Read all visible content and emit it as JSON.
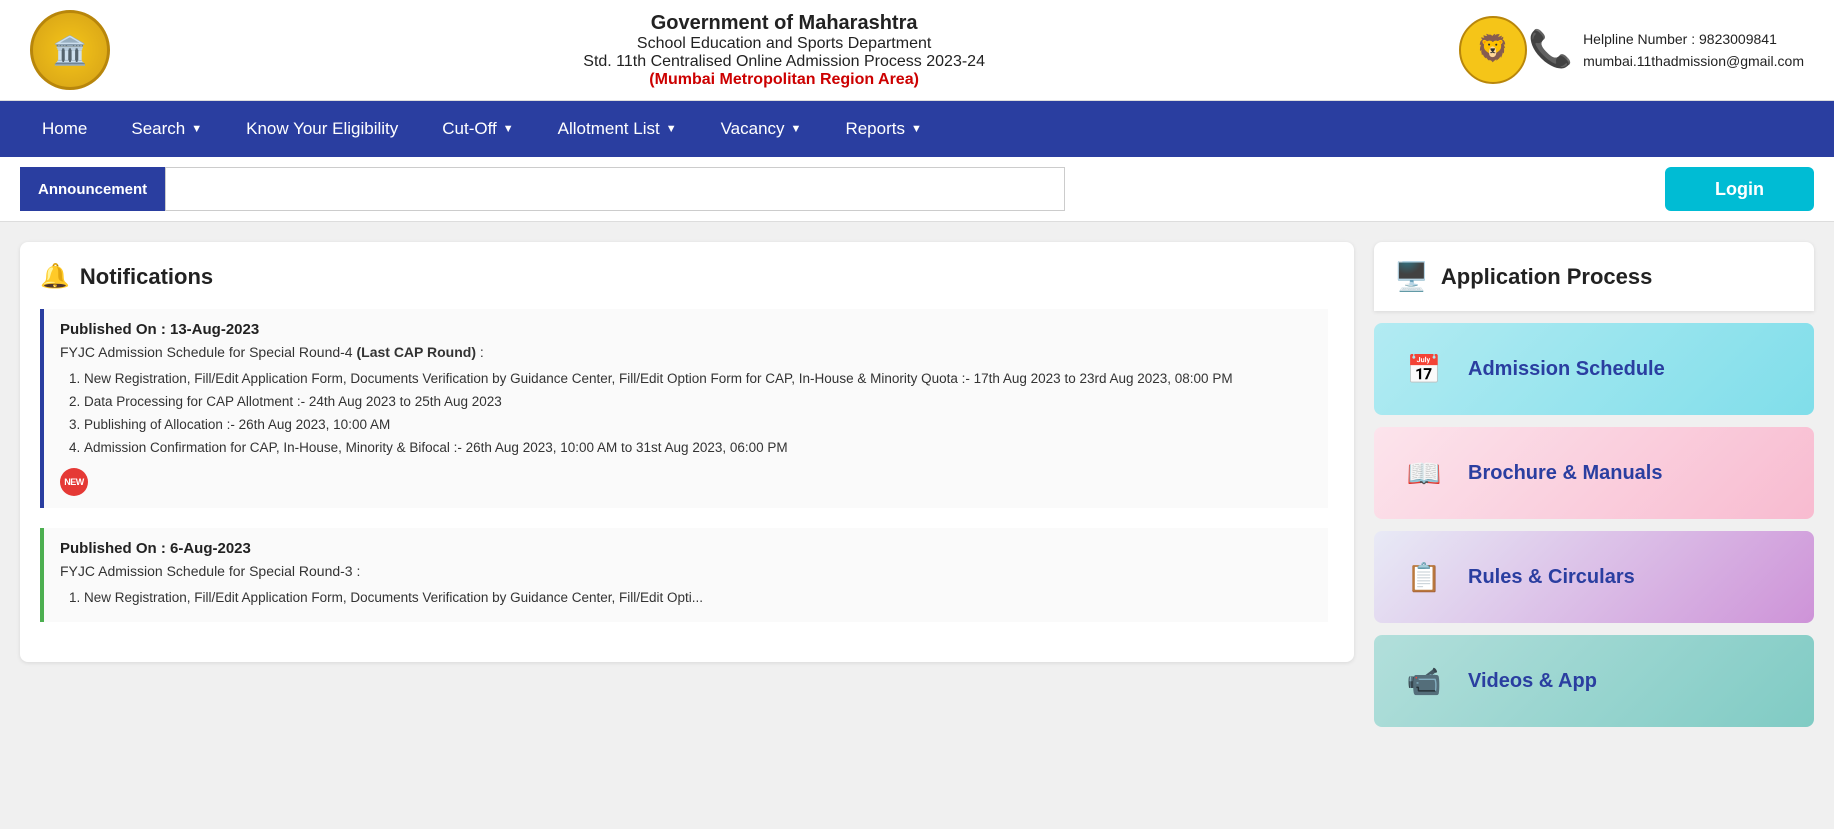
{
  "header": {
    "gov_name": "Government of Maharashtra",
    "dept_name": "School Education and Sports Department",
    "admission_title": "Std. 11th Centralised Online Admission Process 2023-24",
    "region": "(Mumbai Metropolitan Region Area)",
    "helpline_label": "Helpline Number : 9823009841",
    "helpline_email": "mumbai.11thadmission@gmail.com"
  },
  "nav": {
    "items": [
      {
        "label": "Home",
        "hasDropdown": false
      },
      {
        "label": "Search",
        "hasDropdown": true
      },
      {
        "label": "Know Your Eligibility",
        "hasDropdown": false
      },
      {
        "label": "Cut-Off",
        "hasDropdown": true
      },
      {
        "label": "Allotment List",
        "hasDropdown": true
      },
      {
        "label": "Vacancy",
        "hasDropdown": true
      },
      {
        "label": "Reports",
        "hasDropdown": true
      }
    ]
  },
  "announcement": {
    "label": "Announcement",
    "placeholder": "",
    "login_button": "Login"
  },
  "notifications": {
    "title": "Notifications",
    "items": [
      {
        "date": "Published On : 13-Aug-2023",
        "heading": "FYJC Admission Schedule for Special Round-4",
        "heading_bold": "(Last CAP Round)",
        "heading_suffix": " :",
        "list": [
          "New Registration, Fill/Edit Application Form, Documents Verification by Guidance Center, Fill/Edit Option Form for CAP, In-House & Minority Quota :- 17th Aug 2023 to 23rd Aug 2023, 08:00 PM",
          "Data Processing for CAP Allotment :- 24th Aug 2023 to 25th Aug 2023",
          "Publishing of Allocation :- 26th Aug 2023, 10:00 AM",
          "Admission Confirmation for CAP, In-House, Minority & Bifocal :- 26th Aug 2023, 10:00 AM to 31st Aug 2023, 06:00 PM"
        ],
        "has_new_badge": true,
        "border_color": "blue"
      },
      {
        "date": "Published On : 6-Aug-2023",
        "heading": "FYJC Admission Schedule for Special Round-3 :",
        "heading_bold": "",
        "heading_suffix": "",
        "list": [
          "New Registration, Fill/Edit Application Form, Documents Verification by Guidance Center, Fill/Edit Opti..."
        ],
        "has_new_badge": false,
        "border_color": "green"
      }
    ]
  },
  "app_process": {
    "title": "Application Process",
    "cards": [
      {
        "label": "Admission Schedule",
        "color": "cyan",
        "icon": "📅"
      },
      {
        "label": "Brochure & Manuals",
        "color": "pink",
        "icon": "📖"
      },
      {
        "label": "Rules & Circulars",
        "color": "purple",
        "icon": "📋"
      },
      {
        "label": "Videos & App",
        "color": "teal",
        "icon": "📹"
      }
    ]
  }
}
